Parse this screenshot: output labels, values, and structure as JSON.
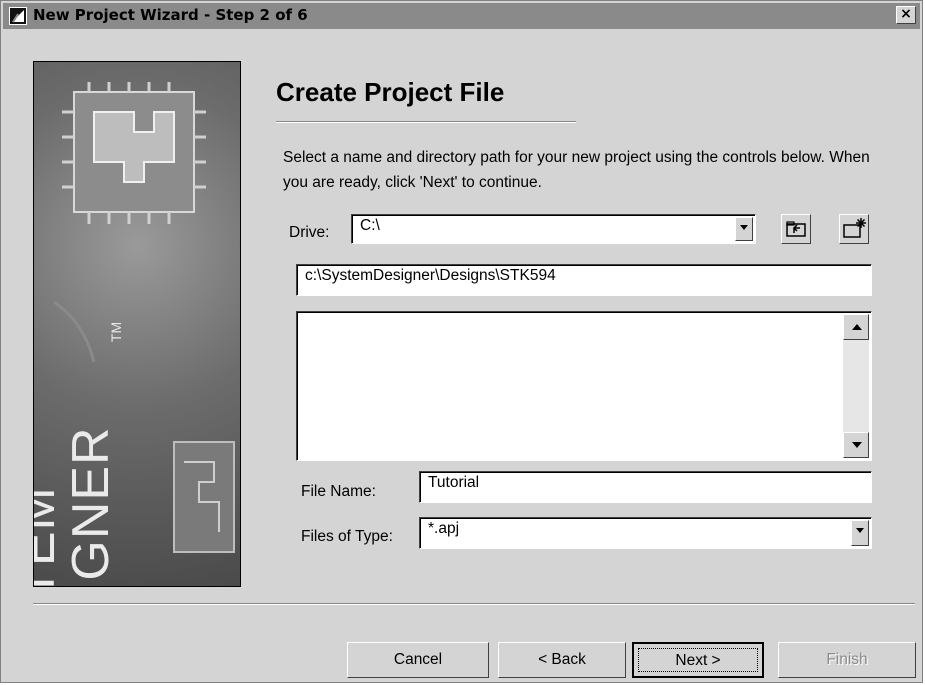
{
  "window": {
    "title": "New Project Wizard - Step 2 of 6",
    "close_glyph": "×"
  },
  "banner": {
    "line1": "SYSTEM",
    "line2": "DESIGNER",
    "trademark": "TM"
  },
  "page": {
    "heading": "Create Project File",
    "description": "Select a name and directory path for your new project using the controls below. When you are ready, click 'Next' to continue."
  },
  "form": {
    "drive_label": "Drive:",
    "drive_value": "C:\\",
    "path_value": "c:\\SystemDesigner\\Designs\\STK594",
    "file_name_label": "File Name:",
    "file_name_value": "Tutorial",
    "file_type_label": "Files of Type:",
    "file_type_value": "*.apj"
  },
  "icons": {
    "up_folder": "up-folder-icon",
    "new_folder": "new-folder-icon",
    "app": "app-icon"
  },
  "buttons": {
    "cancel": "Cancel",
    "back": "< Back",
    "next": "Next >",
    "finish": "Finish"
  }
}
